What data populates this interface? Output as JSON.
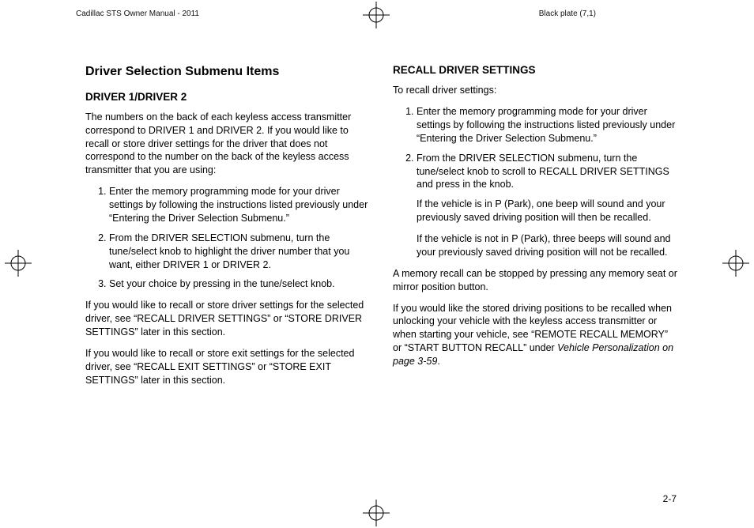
{
  "header": {
    "left": "Cadillac STS Owner Manual - 2011",
    "right": "Black plate (7,1)"
  },
  "page_number": "2-7",
  "left_col": {
    "h2": "Driver Selection Submenu Items",
    "h3": "DRIVER 1/DRIVER 2",
    "p_intro": "The numbers on the back of each keyless access transmitter correspond to DRIVER 1 and DRIVER 2. If you would like to recall or store driver settings for the driver that does not correspond to the number on the back of the keyless access transmitter that you are using:",
    "steps": [
      "Enter the memory programming mode for your driver settings by following the instructions listed previously under “Entering the Driver Selection Submenu.”",
      "From the DRIVER SELECTION submenu, turn the tune/select knob to highlight the driver number that you want, either DRIVER 1 or DRIVER 2.",
      "Set your choice by pressing in the tune/select knob."
    ],
    "p_after1": "If you would like to recall or store driver settings for the selected driver, see “RECALL DRIVER SETTINGS” or “STORE DRIVER SETTINGS” later in this section.",
    "p_after2": "If you would like to recall or store exit settings for the selected driver, see “RECALL EXIT SETTINGS” or “STORE EXIT SETTINGS” later in this section."
  },
  "right_col": {
    "h3": "RECALL DRIVER SETTINGS",
    "p_intro": "To recall driver settings:",
    "steps": [
      "Enter the memory programming mode for your driver settings by following the instructions listed previously under “Entering the Driver Selection Submenu.”",
      "From the DRIVER SELECTION submenu, turn the tune/select knob to scroll to RECALL DRIVER SETTINGS and press in the knob."
    ],
    "note1": "If the vehicle is in P (Park), one beep will sound and your previously saved driving position will then be recalled.",
    "note2": "If the vehicle is not in P (Park), three beeps will sound and your previously saved driving position will not be recalled.",
    "p_after1": "A memory recall can be stopped by pressing any memory seat or mirror position button.",
    "p_after2_a": "If you would like the stored driving positions to be recalled when unlocking your vehicle with the keyless access transmitter or when starting your vehicle, see “REMOTE RECALL MEMORY” or “START BUTTON RECALL” under ",
    "p_after2_ital": "Vehicle Personalization on page 3-59",
    "p_after2_b": "."
  }
}
